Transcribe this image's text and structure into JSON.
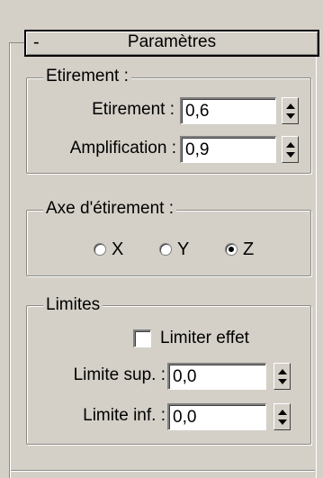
{
  "rollout": {
    "toggle": "-",
    "title": "Paramètres"
  },
  "stretch_group": {
    "title": "Etirement :",
    "stretch_label": "Etirement :",
    "stretch_value": "0,6",
    "amplify_label": "Amplification :",
    "amplify_value": "0,9"
  },
  "axis_group": {
    "title": "Axe d'étirement :",
    "options": [
      {
        "label": "X",
        "selected": false
      },
      {
        "label": "Y",
        "selected": false
      },
      {
        "label": "Z",
        "selected": true
      }
    ]
  },
  "limits_group": {
    "title": "Limites",
    "limit_effect_label": "Limiter effet",
    "limit_effect_checked": false,
    "upper_label": "Limite sup. :",
    "upper_value": "0,0",
    "lower_label": "Limite inf. :",
    "lower_value": "0,0"
  }
}
